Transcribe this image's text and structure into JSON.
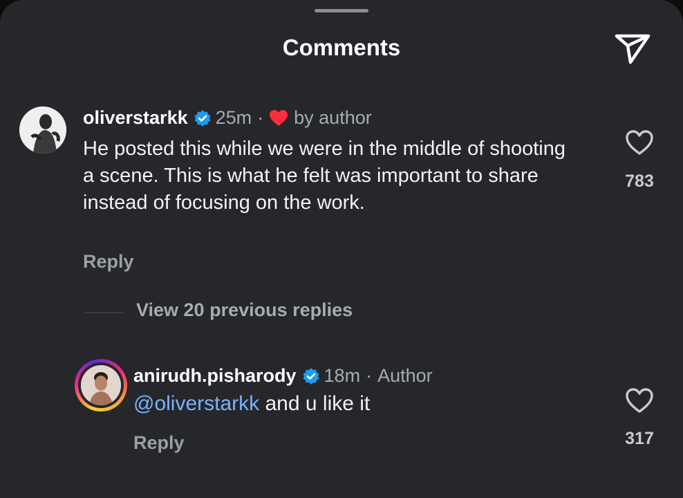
{
  "header": {
    "title": "Comments",
    "share_icon": "paper-plane-icon"
  },
  "comments": [
    {
      "username": "oliverstarkk",
      "verified": true,
      "time": "25m",
      "separator": "·",
      "liked_by_author_label": "by author",
      "text": "He posted this while we were in the middle of shooting a scene. This is what he felt was important to share instead of focusing on the work.",
      "reply_label": "Reply",
      "like_count": "783",
      "icons": [
        "avatar",
        "verified-badge-icon",
        "red-heart-icon",
        "heart-outline-icon"
      ]
    }
  ],
  "thread": {
    "view_previous_label": "View 20 previous replies"
  },
  "replies": [
    {
      "username": "anirudh.pisharody",
      "verified": true,
      "time": "18m",
      "separator": "·",
      "author_label": "Author",
      "mention": "@oliverstarkk",
      "text": " and u like it",
      "reply_label": "Reply",
      "like_count": "317",
      "story_ring": true
    }
  ],
  "colors": {
    "background": "#25272b",
    "text": "#f3f3f3",
    "muted": "#a8abb0",
    "verified": "#1d9bf0",
    "heart_red": "#ff2d3d",
    "mention": "#7ab2ff"
  }
}
